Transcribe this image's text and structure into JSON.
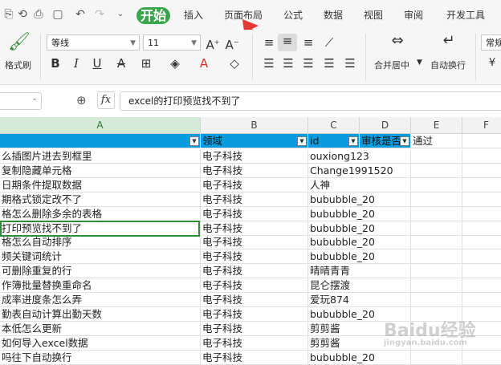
{
  "tabs": [
    "开始",
    "插入",
    "页面布局",
    "公式",
    "数据",
    "视图",
    "审阅",
    "开发工具"
  ],
  "ribbon": {
    "format_painter": "格式刷",
    "font_name": "等线",
    "font_size": "11",
    "merge_center": "合并居中",
    "wrap_text": "自动换行",
    "number_format": "常规"
  },
  "formula_bar": {
    "fx": "fx",
    "content": "excel的打印预览找不到了"
  },
  "columns": [
    "A",
    "B",
    "C",
    "D",
    "E",
    "F"
  ],
  "header_row": {
    "a": "",
    "b": "领域",
    "c": "id",
    "d": "审核是否",
    "e": "通过"
  },
  "rows": [
    {
      "a": "么插图片进去到框里",
      "b": "电子科技",
      "c": "ouxiong123"
    },
    {
      "a": "复制隐藏单元格",
      "b": "电子科技",
      "c": "Change1991520"
    },
    {
      "a": "日期条件提取数据",
      "b": "电子科技",
      "c": "人神"
    },
    {
      "a": "期格式锁定改不了",
      "b": "电子科技",
      "c": "bububble_20"
    },
    {
      "a": "格怎么删除多余的表格",
      "b": "电子科技",
      "c": "bububble_20"
    },
    {
      "a": "打印预览找不到了",
      "b": "电子科技",
      "c": "bububble_20"
    },
    {
      "a": "格怎么自动排序",
      "b": "电子科技",
      "c": "bububble_20"
    },
    {
      "a": "频关键词统计",
      "b": "电子科技",
      "c": "bububble_20"
    },
    {
      "a": "可删除重复的行",
      "b": "电子科技",
      "c": "晴晴青青"
    },
    {
      "a": "作簿批量替换重命名",
      "b": "电子科技",
      "c": "昆仑摆渡"
    },
    {
      "a": "成率进度条怎么弄",
      "b": "电子科技",
      "c": "爱玩874"
    },
    {
      "a": "勤表自动计算出勤天数",
      "b": "电子科技",
      "c": "bububble_20"
    },
    {
      "a": "本低怎么更新",
      "b": "电子科技",
      "c": "剪剪酱"
    },
    {
      "a": "如何导入excel数据",
      "b": "电子科技",
      "c": "剪剪酱"
    },
    {
      "a": "吗往下自动换行",
      "b": "电子科技",
      "c": "bububble_20"
    }
  ],
  "watermark": {
    "text": "Baidu经验",
    "sub": "jingyan.baidu.com"
  },
  "colors": {
    "accent": "#3aa64b",
    "header_fill": "#0b9bdf",
    "selection": "#2e8b3a",
    "arrow": "#e53935"
  }
}
